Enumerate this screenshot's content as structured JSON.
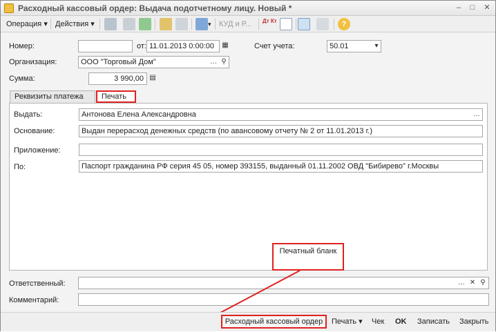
{
  "window": {
    "title": "Расходный кассовый ордер: Выдача подотчетному лицу. Новый *",
    "buttons": {
      "minimize": "–",
      "maximize": "□",
      "close": "✕"
    }
  },
  "toolbar": {
    "operation_label": "Операция",
    "actions_label": "Действия",
    "kudir_label": "КУД и Р...",
    "dtkt_label": "Дт Кт"
  },
  "form": {
    "number_label": "Номер:",
    "number_value": "",
    "date_label": "от:",
    "date_value": "11.01.2013  0:00:00",
    "account_label": "Счет учета:",
    "account_value": "50.01",
    "org_label": "Организация:",
    "org_value": "ООО \"Торговый Дом\"",
    "sum_label": "Сумма:",
    "sum_value": "3 990,00"
  },
  "tabs": {
    "requisites": "Реквизиты платежа",
    "print": "Печать"
  },
  "print_tab": {
    "issue_label": "Выдать:",
    "issue_value": "Антонова Елена Александровна",
    "basis_label": "Основание:",
    "basis_value": "Выдан перерасход денежных средств (по авансовому отчету № 2 от 11.01.2013 г.)",
    "appendix_label": "Приложение:",
    "appendix_value": "",
    "by_label": "По:",
    "by_value": "Паспорт гражданина РФ серия 45 05, номер 393155, выданный 01.11.2002 ОВД \"Бибирево\" г.Москвы"
  },
  "footer": {
    "responsible_label": "Ответственный:",
    "responsible_value": "",
    "comment_label": "Комментарий:",
    "comment_value": ""
  },
  "bottom": {
    "rko_label": "Расходный кассовый ордер",
    "print_label": "Печать",
    "check_label": "Чек",
    "ok_label": "OK",
    "save_label": "Записать",
    "close_label": "Закрыть"
  },
  "annotation": {
    "callout_text": "Печатный бланк"
  },
  "colors": {
    "highlight": "#e02020",
    "window_bg": "#f3f3f3"
  }
}
